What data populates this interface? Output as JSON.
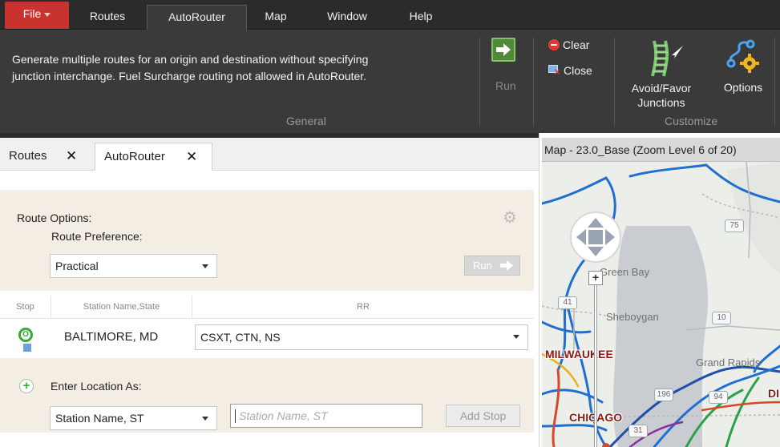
{
  "menu": {
    "file": "File",
    "routes": "Routes",
    "autorouter": "AutoRouter",
    "map": "Map",
    "window": "Window",
    "help": "Help"
  },
  "ribbon": {
    "description_line1": "Generate multiple routes for an origin and destination without specifying",
    "description_line2": "junction interchange. Fuel Surcharge routing not allowed in AutoRouter.",
    "run_label": "Run",
    "clear_label": "Clear",
    "close_label": "Close",
    "group_general": "General",
    "avoid_label_line1": "Avoid/Favor",
    "avoid_label_line2": "Junctions",
    "options_label": "Options",
    "group_customize": "Customize"
  },
  "tabs": [
    {
      "label": "Routes"
    },
    {
      "label": "AutoRouter"
    }
  ],
  "route_options": {
    "title": "Route Options:",
    "preference_label": "Route Preference:",
    "preference_value": "Practical",
    "run_button": "Run"
  },
  "grid": {
    "headers": [
      "Stop",
      "Station Name,State",
      "RR"
    ],
    "rows": [
      {
        "stop": "O",
        "station": "BALTIMORE, MD",
        "rr": "CSXT, CTN, NS"
      }
    ]
  },
  "enter_location": {
    "label": "Enter Location As:",
    "type_value": "Station Name, ST",
    "input_placeholder": "Station Name, ST",
    "add_stop_label": "Add Stop"
  },
  "map": {
    "header": "Map - 23.0_Base (Zoom Level 6 of 20)",
    "labels": {
      "green_bay": "Green Bay",
      "sheboygan": "Sheboygan",
      "milwaukee": "MILWAUKEE",
      "grand_rapids": "Grand Rapids",
      "chicago": "CHICAGO",
      "detroit_partial": "DI"
    },
    "shields": [
      "75",
      "10",
      "196",
      "94",
      "31",
      "41"
    ]
  },
  "colors": {
    "file_red": "#c8332e",
    "ribbon_bg": "#3a3a3a",
    "options_bg": "#f3ede4",
    "stop_green": "#36a93b",
    "rail_blue": "#1f6fd1"
  }
}
